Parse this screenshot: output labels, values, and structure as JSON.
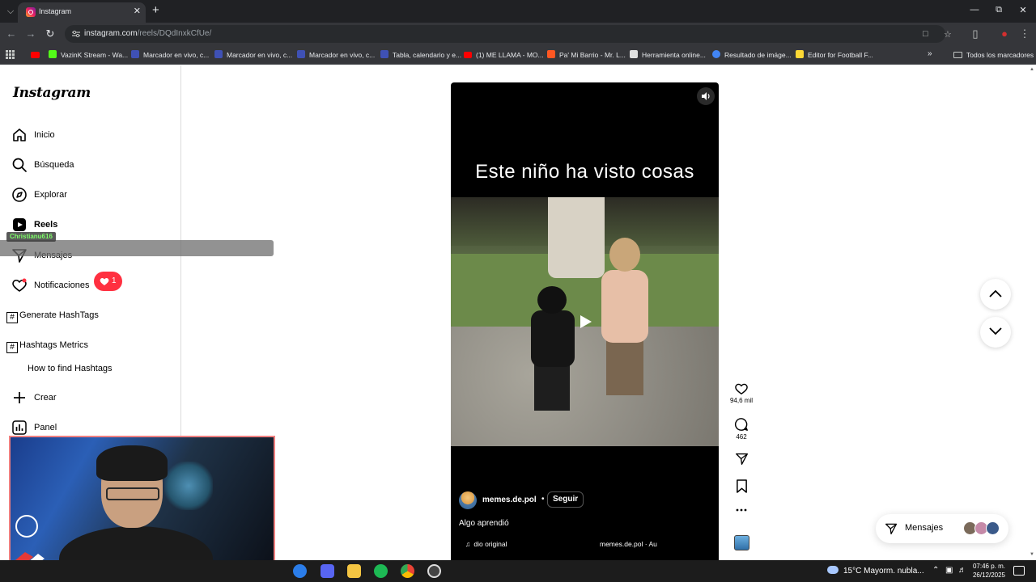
{
  "browser": {
    "tab_title": "Instagram",
    "url_host": "instagram.com",
    "url_path": "/reels/DQdInxkCfUe/",
    "bookmarks": [
      {
        "label": "VazinK Stream - Wa...",
        "icon_color": "#ff0000"
      },
      {
        "label": "Marcador en vivo, c...",
        "icon_color": "#3f51b5"
      },
      {
        "label": "Marcador en vivo, c...",
        "icon_color": "#3f51b5"
      },
      {
        "label": "Marcador en vivo, c...",
        "icon_color": "#3f51b5"
      },
      {
        "label": "Tabla, calendario y e...",
        "icon_color": "#3f51b5"
      },
      {
        "label": "(1) ME LLAMA - MO...",
        "icon_color": "#ff0000"
      },
      {
        "label": "Pa' Mi Barrio - Mr. L...",
        "icon_color": "#ff5722"
      },
      {
        "label": "Herramienta online...",
        "icon_color": "#e0e0e0"
      },
      {
        "label": "Resultado de imáge...",
        "icon_color": "#4285f4"
      },
      {
        "label": "Editor for Football F...",
        "icon_color": "#fdd835"
      }
    ],
    "bookmarks_folder": "Todos los marcadores"
  },
  "sidebar": {
    "logo": "Instagram",
    "items": [
      {
        "label": "Inicio",
        "icon": "home-icon"
      },
      {
        "label": "Búsqueda",
        "icon": "search-icon"
      },
      {
        "label": "Explorar",
        "icon": "compass-icon"
      },
      {
        "label": "Reels",
        "icon": "reels-icon"
      },
      {
        "label": "Mensajes",
        "icon": "send-icon"
      },
      {
        "label": "Notificaciones",
        "icon": "heart-icon"
      },
      {
        "label": "Crear",
        "icon": "plus-icon"
      },
      {
        "label": "Panel",
        "icon": "chart-icon"
      }
    ],
    "notification_count": "1",
    "hashtag_generate": "Generate HashTags",
    "hashtag_metrics": "Hashtags Metrics",
    "hashtag_howto": "How to find Hashtags"
  },
  "stream_overlay": {
    "username": "Christianu616"
  },
  "reel": {
    "caption": "Este niño ha visto cosas",
    "author": "memes.de.pol",
    "follow_label": "Seguir",
    "description": "Algo aprendió",
    "audio": "dio original",
    "audio_author": "memes.de.pol · Au",
    "likes": "94,6 mil",
    "comments": "462"
  },
  "messages_pill": {
    "label": "Mensajes"
  },
  "taskbar": {
    "weather": "15°C  Mayorm. nubla...",
    "time": "07:46 p. m.",
    "date": "26/12/2025"
  }
}
